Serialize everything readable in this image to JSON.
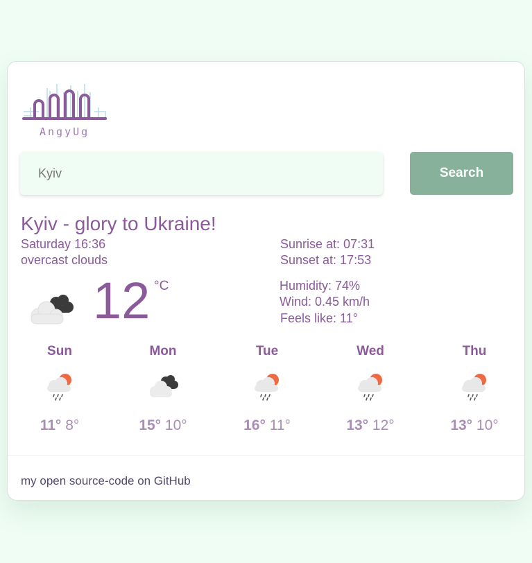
{
  "logo": {
    "text": "AngyUg",
    "color": "#8a5a9b",
    "accent_color": "#b8dbea"
  },
  "search": {
    "placeholder": "Kyiv",
    "button_label": "Search"
  },
  "current": {
    "title": "Kyiv - glory to Ukraine!",
    "datetime": "Saturday 16:36",
    "description": "overcast clouds",
    "icon": "overcast-clouds-icon",
    "temperature": "12",
    "unit": "°C",
    "sunrise": "Sunrise at: 07:31",
    "sunset": "Sunset at: 17:53",
    "humidity": "Humidity: 74%",
    "wind": "Wind: 0.45 km/h",
    "feels_like": "Feels like: 11°"
  },
  "forecast": [
    {
      "day": "Sun",
      "icon": "rain-sun-icon",
      "max": "11°",
      "min": "8°"
    },
    {
      "day": "Mon",
      "icon": "overcast-clouds-icon",
      "max": "15°",
      "min": "10°"
    },
    {
      "day": "Tue",
      "icon": "rain-sun-icon",
      "max": "16°",
      "min": "11°"
    },
    {
      "day": "Wed",
      "icon": "rain-sun-icon",
      "max": "13°",
      "min": "12°"
    },
    {
      "day": "Thu",
      "icon": "rain-sun-icon",
      "max": "13°",
      "min": "10°"
    }
  ],
  "footer": {
    "link_text": "my open source-code on GitHub"
  },
  "colors": {
    "background": "#effdf4",
    "primary_text": "#8a5a9b",
    "button": "#87b19b",
    "sun": "#ee6a43"
  }
}
